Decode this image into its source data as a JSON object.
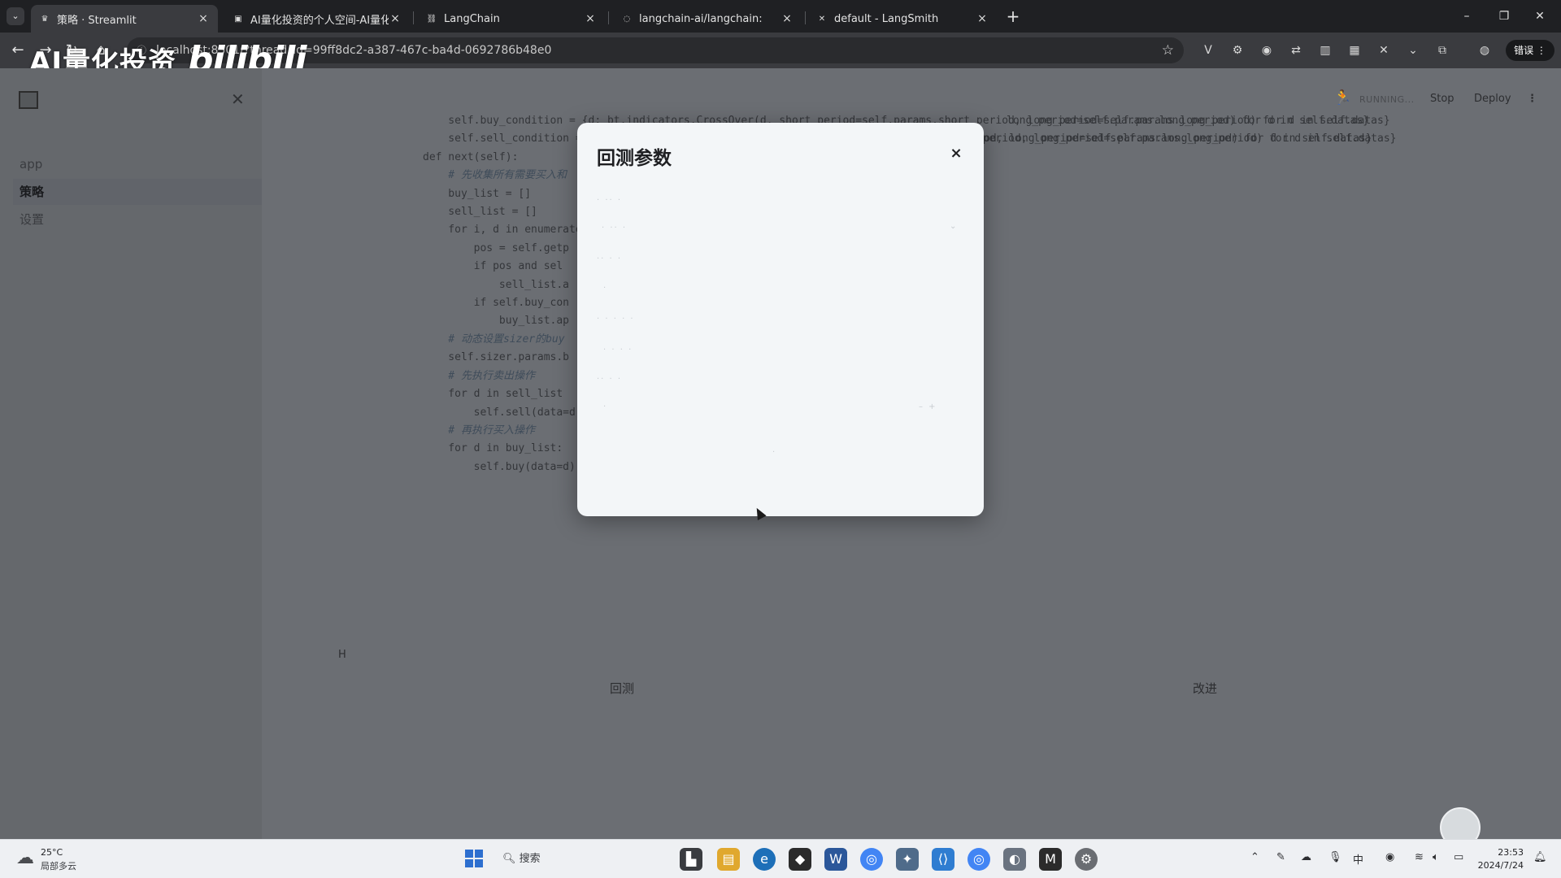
{
  "browser": {
    "tabs": [
      {
        "title": "策略 · Streamlit",
        "icon": "streamlit-crown-icon",
        "active": true
      },
      {
        "title": "AI量化投资的个人空间-AI量化",
        "icon": "bilibili-tv-icon",
        "active": false
      },
      {
        "title": "LangChain",
        "icon": "langchain-icon",
        "active": false
      },
      {
        "title": "langchain-ai/langchain:",
        "icon": "github-loading-icon",
        "active": false
      },
      {
        "title": "default - LangSmith",
        "icon": "langsmith-icon",
        "active": false
      }
    ],
    "address": "localhost:8501/?thread_id=99ff8dc2-a387-467c-ba4d-0692786b48e0",
    "profile_badge": "错误"
  },
  "watermark": {
    "text": "AI量化投资",
    "brand": "bilibili"
  },
  "sidebar": {
    "items": [
      {
        "label": "app",
        "selected": false
      },
      {
        "label": "策略",
        "selected": true
      },
      {
        "label": "设置",
        "selected": false
      }
    ]
  },
  "header": {
    "status": "RUNNING...",
    "stop_label": "Stop",
    "deploy_label": "Deploy"
  },
  "code": {
    "lines": [
      {
        "text": "    self.buy_condition = {d: bt.indicators.CrossOver(d, short_period=self.params.short_period, long_period=self.params.long_period) for d in self.datas}",
        "comment": false
      },
      {
        "text": "    self.sell_condition = {d: bt.indicators.CrossOver(d, short_period=self.params.short_period, long_period=self.params.long_period) for d in self.datas}",
        "comment": false
      },
      {
        "text": "",
        "comment": false
      },
      {
        "text": "def next(self):",
        "comment": false
      },
      {
        "text": "    # 先收集所有需要买入和",
        "comment": true
      },
      {
        "text": "    buy_list = []",
        "comment": false
      },
      {
        "text": "    sell_list = []",
        "comment": false
      },
      {
        "text": "",
        "comment": false
      },
      {
        "text": "    for i, d in enumerate",
        "comment": false
      },
      {
        "text": "        pos = self.getp",
        "comment": false
      },
      {
        "text": "",
        "comment": false
      },
      {
        "text": "        if pos and sel",
        "comment": false
      },
      {
        "text": "            sell_list.a",
        "comment": false
      },
      {
        "text": "",
        "comment": false
      },
      {
        "text": "        if self.buy_con",
        "comment": false
      },
      {
        "text": "            buy_list.ap",
        "comment": false
      },
      {
        "text": "",
        "comment": false
      },
      {
        "text": "    # 动态设置sizer的buy",
        "comment": true
      },
      {
        "text": "    self.sizer.params.b",
        "comment": false
      },
      {
        "text": "",
        "comment": false
      },
      {
        "text": "    # 先执行卖出操作",
        "comment": true
      },
      {
        "text": "    for d in sell_list",
        "comment": false
      },
      {
        "text": "        self.sell(data=d)",
        "comment": false
      },
      {
        "text": "",
        "comment": false
      },
      {
        "text": "    # 再执行买入操作",
        "comment": true
      },
      {
        "text": "    for d in buy_list:",
        "comment": false
      },
      {
        "text": "        self.buy(data=d)",
        "comment": false
      }
    ],
    "right_fragment_1": "od, long_period=self.params.long_period) for d in self.datas}",
    "right_fragment_0": "long_period=self.params.long_period) for d in self.datas}"
  },
  "main": {
    "h_label": "H",
    "backtest_label": "回测",
    "improve_label": "改进"
  },
  "modal": {
    "title": "回测参数",
    "close_label": "×"
  },
  "taskbar": {
    "weather_temp": "25°C",
    "weather_desc": "局部多云",
    "search_label": "搜索",
    "ime": "中",
    "time": "23:53",
    "date": "2024/7/24"
  },
  "colors": {
    "accent": "#2d6fcf",
    "modal_bg": "#f3f6f8",
    "overlay": "#6b6e73"
  }
}
